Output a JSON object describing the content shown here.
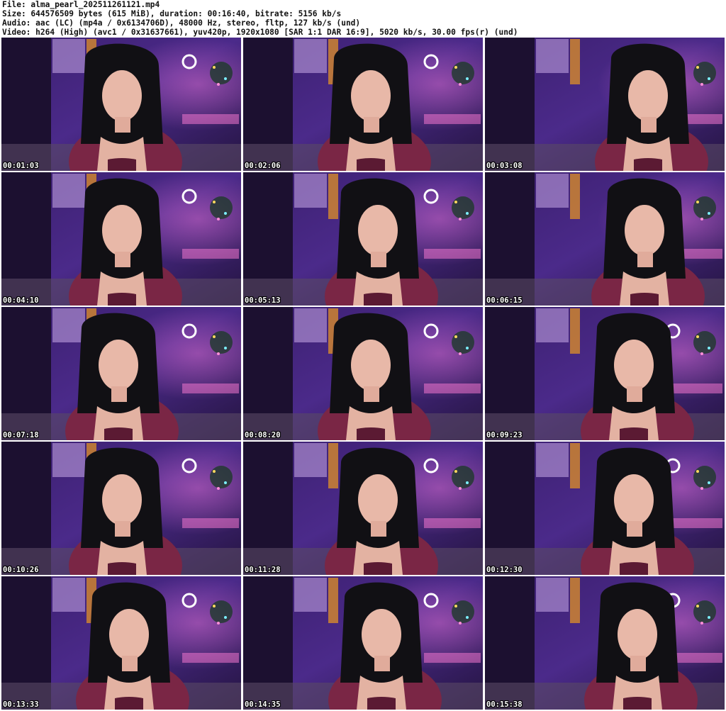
{
  "header": {
    "file_line": "File: alma_pearl_202511261121.mp4",
    "size_line": "Size: 644576509 bytes (615 MiB), duration: 00:16:40, bitrate: 5156 kb/s",
    "audio_line": "Audio: aac (LC) (mp4a / 0x6134706D), 48000 Hz, stereo, fltp, 127 kb/s (und)",
    "video_line": "Video: h264 (High) (avc1 / 0x31637661), yuv420p, 1920x1080 [SAR 1:1 DAR 16:9], 5020 kb/s, 30.00 fps(r) (und)"
  },
  "thumbnails": [
    {
      "timestamp": "00:01:03"
    },
    {
      "timestamp": "00:02:06"
    },
    {
      "timestamp": "00:03:08"
    },
    {
      "timestamp": "00:04:10"
    },
    {
      "timestamp": "00:05:13"
    },
    {
      "timestamp": "00:06:15"
    },
    {
      "timestamp": "00:07:18"
    },
    {
      "timestamp": "00:08:20"
    },
    {
      "timestamp": "00:09:23"
    },
    {
      "timestamp": "00:10:26"
    },
    {
      "timestamp": "00:11:28"
    },
    {
      "timestamp": "00:12:30"
    },
    {
      "timestamp": "00:13:33"
    },
    {
      "timestamp": "00:14:35"
    },
    {
      "timestamp": "00:15:38"
    }
  ]
}
